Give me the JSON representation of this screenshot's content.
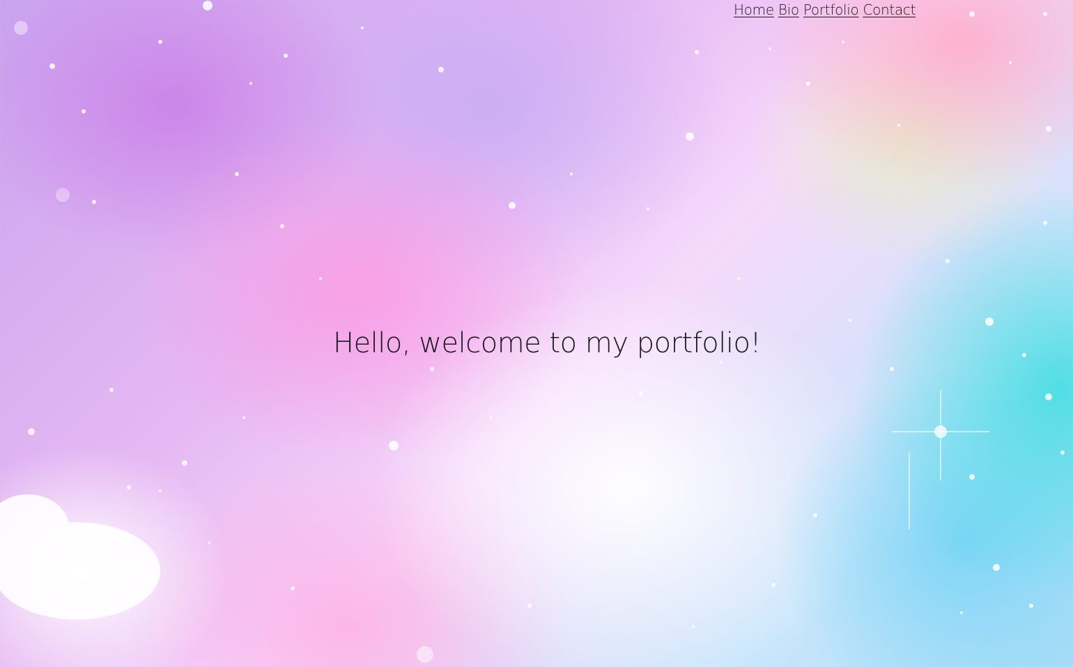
{
  "nav": {
    "items": [
      {
        "label": "Home"
      },
      {
        "label": "Bio"
      },
      {
        "label": "Portfolio"
      },
      {
        "label": "Contact"
      }
    ]
  },
  "hero": {
    "heading": "Hello, welcome to my portfolio!"
  },
  "colors": {
    "text": "#1a1a1a",
    "background_accent_pink": "#f59ae0",
    "background_accent_purple": "#c9a3ee",
    "background_accent_cyan": "#3cdce1"
  }
}
